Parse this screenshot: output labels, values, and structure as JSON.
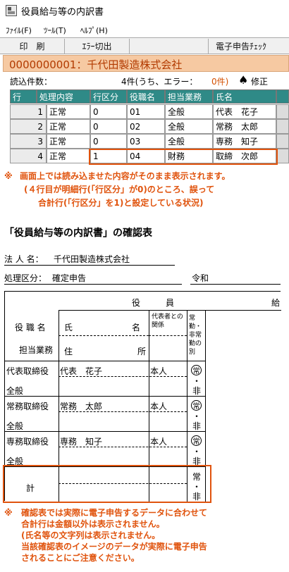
{
  "window": {
    "title": "役員給与等の内訳書"
  },
  "menu": [
    {
      "label": "ﾌｧｲﾙ(F)"
    },
    {
      "label": "ﾂｰﾙ(T)"
    },
    {
      "label": "ﾍﾙﾌﾟ(H)"
    }
  ],
  "toolbar": {
    "print": "印　刷",
    "error_toggle": "ｴﾗｰ切出",
    "efile_check": "電子申告ﾁｪｯｸ"
  },
  "company": {
    "code_name": "0000000001：千代田製造株式会社"
  },
  "status": {
    "count_label": "読込件数：",
    "count_value": "4件(うち、エラー：",
    "error_value": "0件)",
    "spade": "♠",
    "fix_label": "修正"
  },
  "grid": {
    "headers": [
      "行",
      "処理内容",
      "行区分",
      "役職名",
      "担当業務",
      "氏名"
    ],
    "rows": [
      {
        "no": "1",
        "process": "正常",
        "row_type": "0",
        "title": "01",
        "duty": "全般",
        "name": "代表　花子"
      },
      {
        "no": "2",
        "process": "正常",
        "row_type": "0",
        "title": "02",
        "duty": "全般",
        "name": "常務　太郎"
      },
      {
        "no": "3",
        "process": "正常",
        "row_type": "0",
        "title": "03",
        "duty": "全般",
        "name": "専務　知子"
      },
      {
        "no": "4",
        "process": "正常",
        "row_type": "1",
        "title": "04",
        "duty": "財務",
        "name": "取締　次郎"
      }
    ]
  },
  "note1": {
    "mark": "※",
    "line1": "画面上では読み込ませた内容がそのまま表示されます。",
    "line2": "(４行目が明細行(「行区分」が0)のところ、誤って",
    "line3": "合計行(「行区分」を1)と設定している状況)"
  },
  "section_title": "「役員給与等の内訳書」の確認表",
  "sheet": {
    "corp_label": "法 人 名：",
    "corp_name": "千代田製造株式会社",
    "proc_label": "処理区分：",
    "proc_value": "確定申告",
    "era": "令和",
    "head_officer": "役　　　員",
    "head_salary": "給",
    "col_title": "役 職 名",
    "col_duty": "担当業務",
    "col_name_left": "氏",
    "col_name_right": "名",
    "col_address_left": "住",
    "col_address_right": "所",
    "col_relation": "代表者との関係",
    "col_fulltime": "常勤・非常勤の別",
    "rows": [
      {
        "title": "代表取締役",
        "duty": "全般",
        "name": "代表　花子",
        "relation": "本人",
        "ft1": "常",
        "ft2": "非"
      },
      {
        "title": "常務取締役",
        "duty": "全般",
        "name": "常務　太郎",
        "relation": "本人",
        "ft1": "常",
        "ft2": "非"
      },
      {
        "title": "専務取締役",
        "duty": "全般",
        "name": "専務　知子",
        "relation": "本人",
        "ft1": "常",
        "ft2": "非"
      }
    ],
    "total_label": "計",
    "total_ft1": "常",
    "total_ft2": "非",
    "dot": "・"
  },
  "note2": {
    "mark": "※",
    "line1": "確認表では実際に電子申告するデータに合わせて",
    "line2": "合計行は金額以外は表示されません。",
    "line3": "(氏名等の文字列は表示されません。",
    "line4": "当該確認表のイメージのデータが実際に電子申告",
    "line5": "されることにご注意ください。"
  }
}
